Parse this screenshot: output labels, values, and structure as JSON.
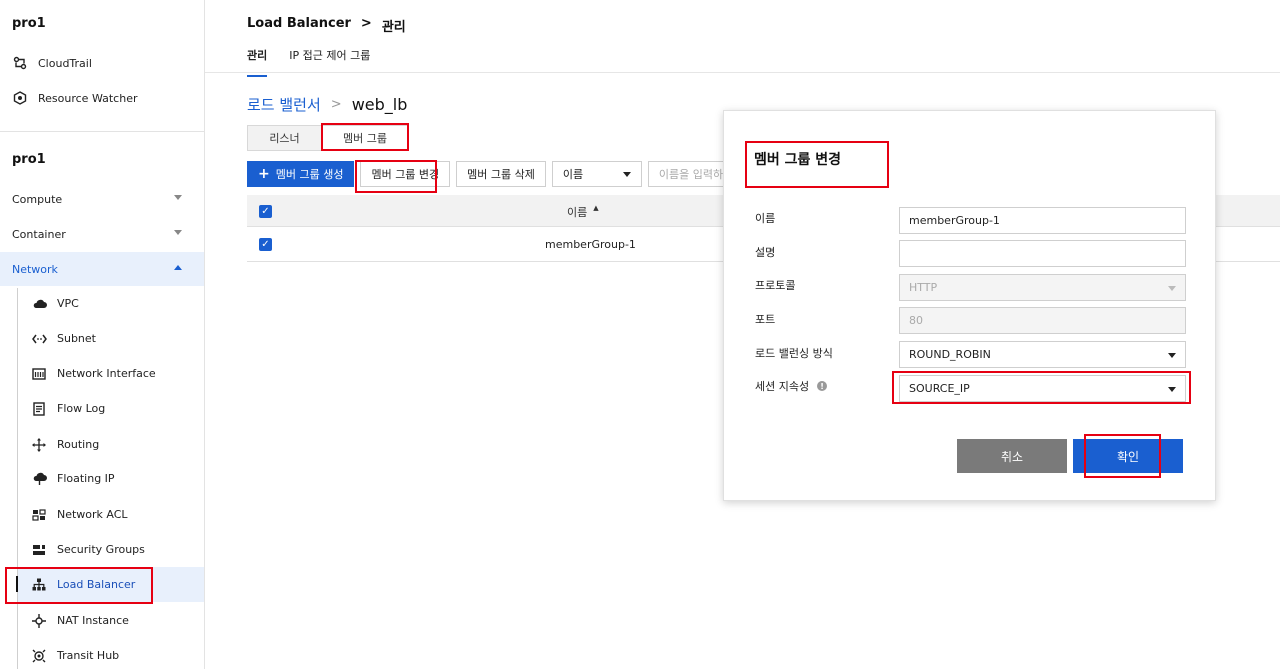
{
  "sidebar": {
    "project_top": "pro1",
    "tools": [
      {
        "label": "CloudTrail",
        "icon": "cloudtrail-icon"
      },
      {
        "label": "Resource Watcher",
        "icon": "resource-watcher-icon"
      }
    ],
    "project_main": "pro1",
    "categories": [
      {
        "label": "Compute"
      },
      {
        "label": "Container"
      },
      {
        "label": "Network"
      }
    ],
    "network_items": [
      {
        "label": "VPC",
        "icon": "cloud-icon"
      },
      {
        "label": "Subnet",
        "icon": "subnet-icon"
      },
      {
        "label": "Network Interface",
        "icon": "network-interface-icon"
      },
      {
        "label": "Flow Log",
        "icon": "flow-log-icon"
      },
      {
        "label": "Routing",
        "icon": "routing-icon"
      },
      {
        "label": "Floating IP",
        "icon": "floating-ip-icon"
      },
      {
        "label": "Network ACL",
        "icon": "network-acl-icon"
      },
      {
        "label": "Security Groups",
        "icon": "security-groups-icon"
      },
      {
        "label": "Load Balancer",
        "icon": "load-balancer-icon"
      },
      {
        "label": "NAT Instance",
        "icon": "nat-instance-icon"
      },
      {
        "label": "Transit Hub",
        "icon": "transit-hub-icon"
      }
    ]
  },
  "header": {
    "crumb_service": "Load Balancer",
    "crumb_sep": ">",
    "crumb_page": "관리",
    "tabs": [
      "관리",
      "IP 접근 제어 그룹"
    ]
  },
  "lb_breadcrumb": {
    "parent": "로드 밸런서",
    "sep": ">",
    "current": "web_lb"
  },
  "subtabs": [
    "리스너",
    "멤버 그룹"
  ],
  "toolbar": {
    "create": "멤버 그룹 생성",
    "create_icon": "+",
    "edit": "멤버 그룹 변경",
    "delete": "멤버 그룹 삭제",
    "filter_select": "이름",
    "search_placeholder": "이름을 입력하세요"
  },
  "table": {
    "header_name": "이름",
    "sort_glyph": "▲",
    "checkmark": "✓",
    "rows": [
      {
        "name": "memberGroup-1"
      }
    ]
  },
  "modal": {
    "title": "멤버 그룹 변경",
    "fields": {
      "name": {
        "label": "이름",
        "value": "memberGroup-1"
      },
      "desc": {
        "label": "설명",
        "value": ""
      },
      "protocol": {
        "label": "프로토콜",
        "value": "HTTP"
      },
      "port": {
        "label": "포트",
        "value": "80"
      },
      "method": {
        "label": "로드 밸런싱 방식",
        "value": "ROUND_ROBIN"
      },
      "session": {
        "label": "세션 지속성",
        "value": "SOURCE_IP",
        "info": "!"
      }
    },
    "cancel": "취소",
    "confirm": "확인"
  },
  "colors": {
    "accent": "#1a5fd0",
    "highlight": "#e60012",
    "cancel": "#7a7a7a"
  }
}
